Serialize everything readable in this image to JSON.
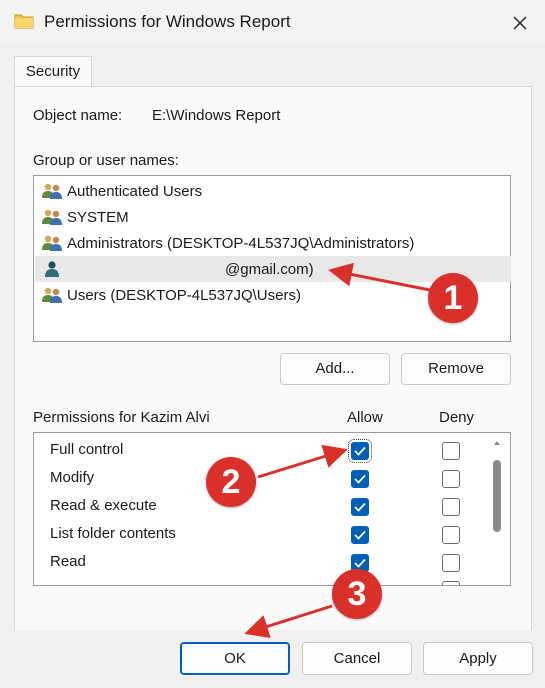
{
  "window": {
    "title": "Permissions for Windows Report",
    "close_icon": "close-icon"
  },
  "tabs": [
    {
      "label": "Security"
    }
  ],
  "object": {
    "label": "Object name:",
    "value": "E:\\Windows Report"
  },
  "group": {
    "label": "Group or user names:",
    "users": [
      {
        "name": "Authenticated Users",
        "icon": "user-group-icon"
      },
      {
        "name": "SYSTEM",
        "icon": "user-group-icon"
      },
      {
        "name": "Administrators (DESKTOP-4L537JQ\\Administrators)",
        "icon": "user-group-icon"
      },
      {
        "name": "@gmail.com)",
        "icon": "user-icon",
        "selected": true
      },
      {
        "name": "Users (DESKTOP-4L537JQ\\Users)",
        "icon": "user-group-icon"
      }
    ],
    "add_label": "Add...",
    "remove_label": "Remove"
  },
  "permissions": {
    "label": "Permissions for Kazim Alvi",
    "allow_header": "Allow",
    "deny_header": "Deny",
    "rows": [
      {
        "name": "Full control",
        "allow": true,
        "deny": false
      },
      {
        "name": "Modify",
        "allow": true,
        "deny": false
      },
      {
        "name": "Read & execute",
        "allow": true,
        "deny": false
      },
      {
        "name": "List folder contents",
        "allow": true,
        "deny": false
      },
      {
        "name": "Read",
        "allow": true,
        "deny": false
      }
    ]
  },
  "footer": {
    "ok_label": "OK",
    "cancel_label": "Cancel",
    "apply_label": "Apply"
  },
  "annotations": {
    "badge1": "1",
    "badge2": "2",
    "badge3": "3"
  },
  "colors": {
    "accent": "#005fb8",
    "annotation": "#d9302a",
    "selection": "#e8e8e8"
  }
}
